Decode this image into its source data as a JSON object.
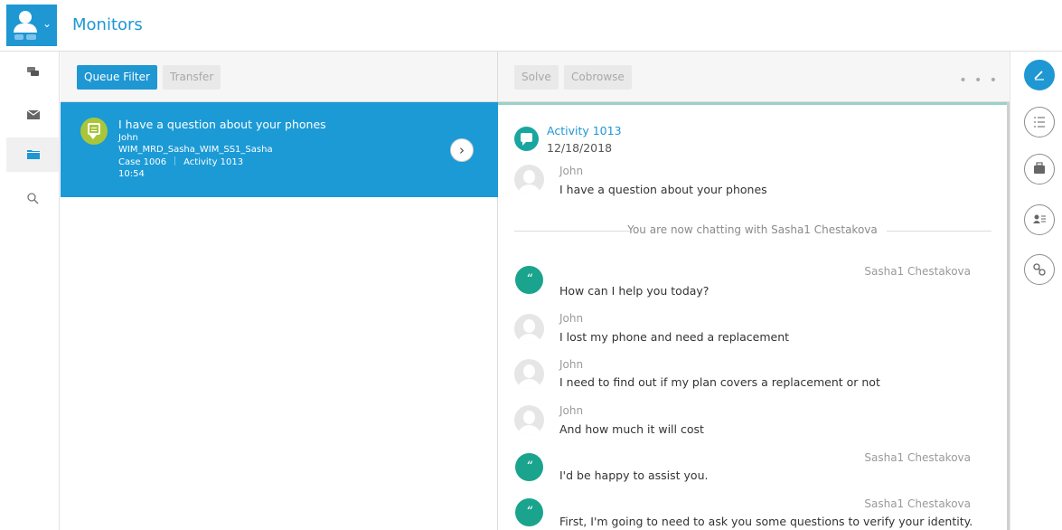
{
  "header": {
    "title": "Monitors"
  },
  "queue": {
    "toolbar": {
      "queue_filter": "Queue Filter",
      "transfer": "Transfer"
    },
    "item": {
      "title": "I have a question about your phones",
      "contact": "John",
      "queue": "WIM_MRD_Sasha_WIM_SS1_Sasha",
      "case": "Case 1006",
      "activity": "Activity 1013",
      "time": "10:54"
    }
  },
  "chat": {
    "toolbar": {
      "solve": "Solve",
      "cobrowse": "Cobrowse"
    },
    "activity": {
      "title": "Activity 1013",
      "date": "12/18/2018"
    },
    "first_message": {
      "name": "John",
      "text": "I have a question about your phones"
    },
    "system_message": "You are now chatting with Sasha1 Chestakova",
    "messages": [
      {
        "name": "Sasha1 Chestakova",
        "text": "How can I help you today?"
      },
      {
        "name": "John",
        "text": "I lost my phone and need a replacement"
      },
      {
        "name": "John",
        "text": "I need to find out if my plan covers a replacement or not"
      },
      {
        "name": "John",
        "text": "And how much it will cost"
      },
      {
        "name": "Sasha1 Chestakova",
        "text": "I'd be happy to assist you."
      },
      {
        "name": "Sasha1 Chestakova",
        "text": "First, I'm going to need to ask you some questions to verify your identity."
      }
    ]
  },
  "icons": {
    "nav": [
      "chat-icon",
      "mail-icon",
      "folder-icon",
      "search-icon"
    ],
    "right_rail": [
      "edit-icon",
      "list-icon",
      "briefcase-icon",
      "contact-card-icon",
      "link-icon"
    ]
  },
  "colors": {
    "accent": "#1e97d3",
    "agent": "#1aa48d",
    "queue_icon": "#a9c53a"
  }
}
